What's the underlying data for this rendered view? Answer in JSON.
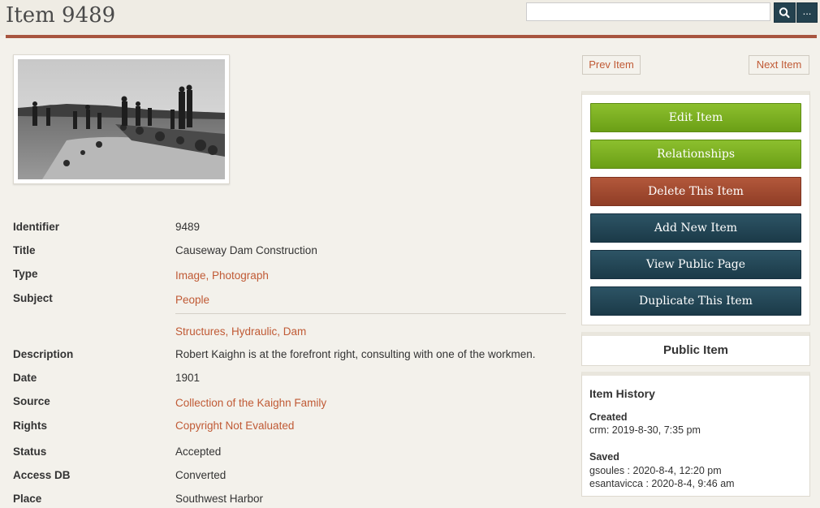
{
  "header": {
    "title": "Item 9489",
    "search": {
      "value": "",
      "placeholder": ""
    },
    "search_icon": "search-icon",
    "more_label": "..."
  },
  "photo": {
    "alt": "Black and white photograph of workmen constructing the causeway dam"
  },
  "metadata": {
    "identifier": {
      "label": "Identifier",
      "value": "9489"
    },
    "title": {
      "label": "Title",
      "value": "Causeway Dam Construction"
    },
    "type": {
      "label": "Type",
      "value": "Image, Photograph"
    },
    "subject": {
      "label": "Subject",
      "values": [
        "People",
        "Structures, Hydraulic, Dam"
      ]
    },
    "description": {
      "label": "Description",
      "value": "Robert Kaighn is at the forefront right, consulting with one of the workmen."
    },
    "date": {
      "label": "Date",
      "value": "1901"
    },
    "source": {
      "label": "Source",
      "value": "Collection of the Kaighn Family"
    },
    "rights": {
      "label": "Rights",
      "value": "Copyright Not Evaluated"
    },
    "status": {
      "label": "Status",
      "value": "Accepted"
    },
    "access_db": {
      "label": "Access DB",
      "value": "Converted"
    },
    "place": {
      "label": "Place",
      "value": "Southwest Harbor"
    }
  },
  "nav": {
    "prev": "Prev Item",
    "next": "Next Item"
  },
  "actions": {
    "edit": "Edit Item",
    "relationships": "Relationships",
    "delete": "Delete This Item",
    "add": "Add New Item",
    "view_public": "View Public Page",
    "duplicate": "Duplicate This Item"
  },
  "public_status": "Public Item",
  "history": {
    "title": "Item History",
    "created_label": "Created",
    "created": [
      "crm: 2019-8-30, 7:35 pm"
    ],
    "saved_label": "Saved",
    "saved": [
      "gsoules : 2020-8-4, 12:20 pm",
      "esantavicca : 2020-8-4, 9:46 am"
    ]
  },
  "colors": {
    "accent_rule": "#a8553f",
    "link": "#c05a35",
    "green_button": "#7cae22",
    "red_button": "#a14a30",
    "navy_button": "#24424f"
  }
}
